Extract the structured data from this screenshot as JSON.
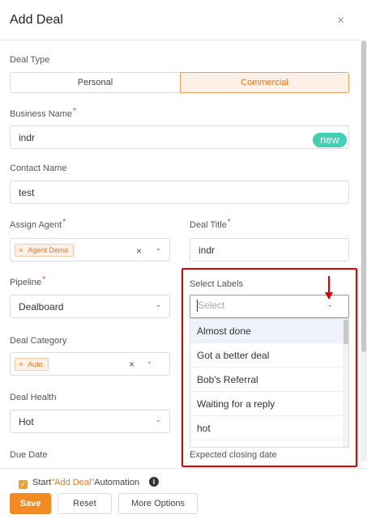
{
  "modal": {
    "title": "Add Deal",
    "close_glyph": "×"
  },
  "form": {
    "deal_type": {
      "label": "Deal Type",
      "options": [
        "Personal",
        "Commercial"
      ],
      "selected": "Commercial"
    },
    "business_name": {
      "label": "Business Name",
      "required_mark": "*",
      "value": "indr",
      "badge": "new"
    },
    "contact_name": {
      "label": "Contact Name",
      "value": "test"
    },
    "assign_agent": {
      "label": "Assign Agent",
      "required_mark": "*",
      "tags": [
        "Agent Demo"
      ],
      "tag_remove": "×",
      "clear_glyph": "×"
    },
    "deal_title": {
      "label": "Deal Title",
      "required_mark": "*",
      "value": "indr"
    },
    "pipeline": {
      "label": "Pipeline",
      "required_mark": "*",
      "value": "Dealboard"
    },
    "select_labels": {
      "label": "Select Labels",
      "placeholder": "Select",
      "options": [
        "Almost done",
        "Got a better deal",
        "Bob's Referral",
        "Waiting for a reply",
        "hot"
      ]
    },
    "deal_category": {
      "label": "Deal Category",
      "tags": [
        "Auto"
      ],
      "tag_remove": "×",
      "clear_glyph": "×"
    },
    "deal_health": {
      "label": "Deal Health",
      "value": "Hot"
    },
    "due_date": {
      "label": "Due Date"
    },
    "expected_closing_date": {
      "label": "Expected closing date"
    }
  },
  "footer": {
    "automation_prefix": "Start",
    "automation_highlight": "\"Add Deal\"",
    "automation_suffix": "Automation",
    "automation_checked": true,
    "info_glyph": "i",
    "save_label": "Save",
    "reset_label": "Reset",
    "more_label": "More Options"
  },
  "icons": {
    "chevron": "chevron-down-icon",
    "close": "close-icon",
    "info": "info-icon",
    "check": "check-icon"
  },
  "colors": {
    "accent": "#f48a22",
    "badge_new": "#3fd1b1",
    "annotation": "#e00000"
  }
}
